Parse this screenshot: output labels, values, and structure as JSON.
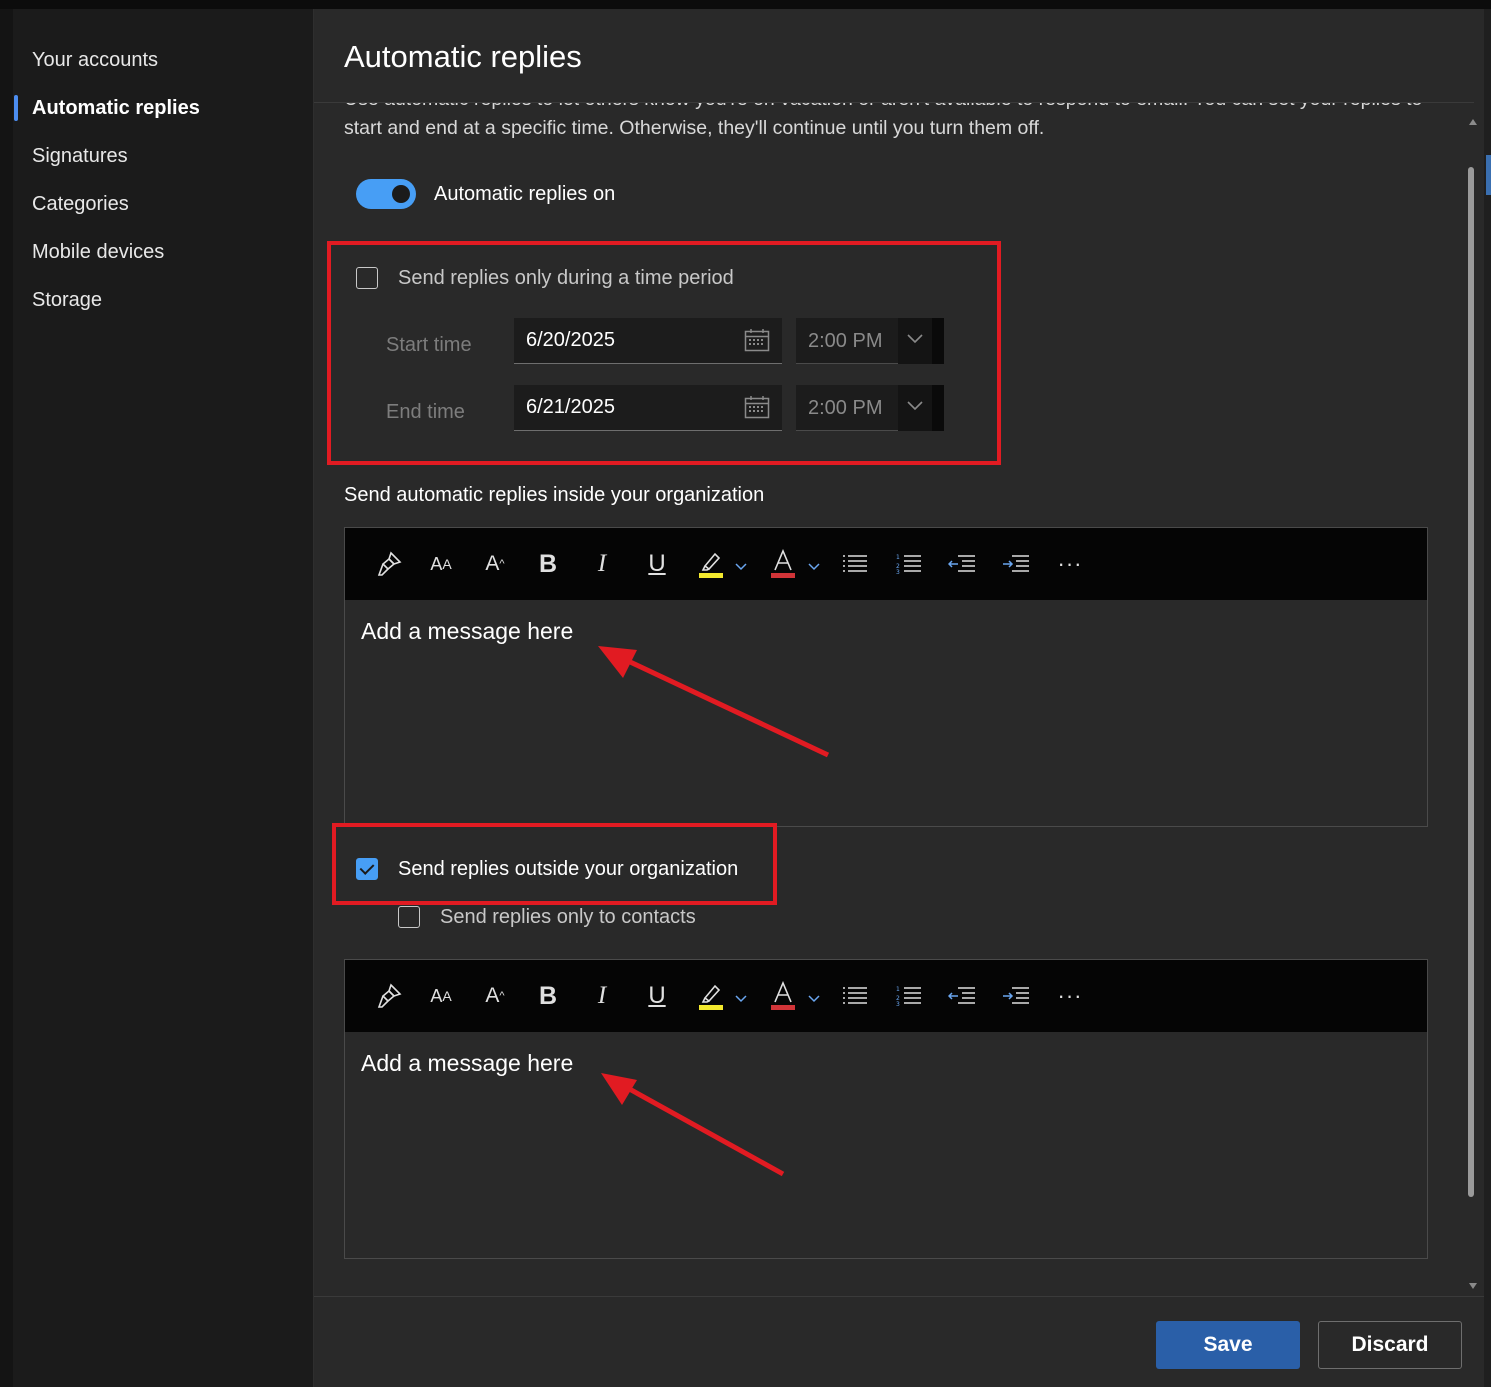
{
  "sidebar": {
    "items": [
      {
        "label": "Your accounts"
      },
      {
        "label": "Automatic replies",
        "active": true
      },
      {
        "label": "Signatures"
      },
      {
        "label": "Categories"
      },
      {
        "label": "Mobile devices"
      },
      {
        "label": "Storage"
      }
    ]
  },
  "panel": {
    "title": "Automatic replies",
    "intro": "Use automatic replies to let others know you're on vacation or aren't available to respond to email. You can set your replies to start and end at a specific time. Otherwise, they'll continue until you turn them off.",
    "toggle": {
      "label": "Automatic replies on",
      "on": true
    },
    "time_period": {
      "checkbox_label": "Send replies only during a time period",
      "checked": false,
      "start_label": "Start time",
      "start_date": "6/20/2025",
      "start_time": "2:00 PM",
      "end_label": "End time",
      "end_date": "6/21/2025",
      "end_time": "2:00 PM"
    },
    "inside_label": "Send automatic replies inside your organization",
    "inside_editor": {
      "placeholder": "Add a message here"
    },
    "outside": {
      "checkbox_label": "Send replies outside your organization",
      "checked": true,
      "contacts_label": "Send replies only to contacts",
      "contacts_checked": false
    },
    "outside_editor": {
      "placeholder": "Add a message here"
    },
    "toolbar_icons": [
      "format-painter-icon",
      "font-size-icon",
      "superscript-icon",
      "bold-icon",
      "italic-icon",
      "underline-icon",
      "highlight-icon",
      "font-color-icon",
      "bullets-icon",
      "numbering-icon",
      "decrease-indent-icon",
      "increase-indent-icon",
      "more-options-icon"
    ],
    "toolbar_glyphs": {
      "bold": "B",
      "italic": "I",
      "underline": "U",
      "more": "···"
    }
  },
  "footer": {
    "save_label": "Save",
    "discard_label": "Discard"
  },
  "colors": {
    "accent": "#479ef5",
    "annotation_red": "#e11b22",
    "save_button": "#2a5fa8",
    "highlight_yellow": "#f3e92e",
    "font_color_red": "#d13438"
  }
}
